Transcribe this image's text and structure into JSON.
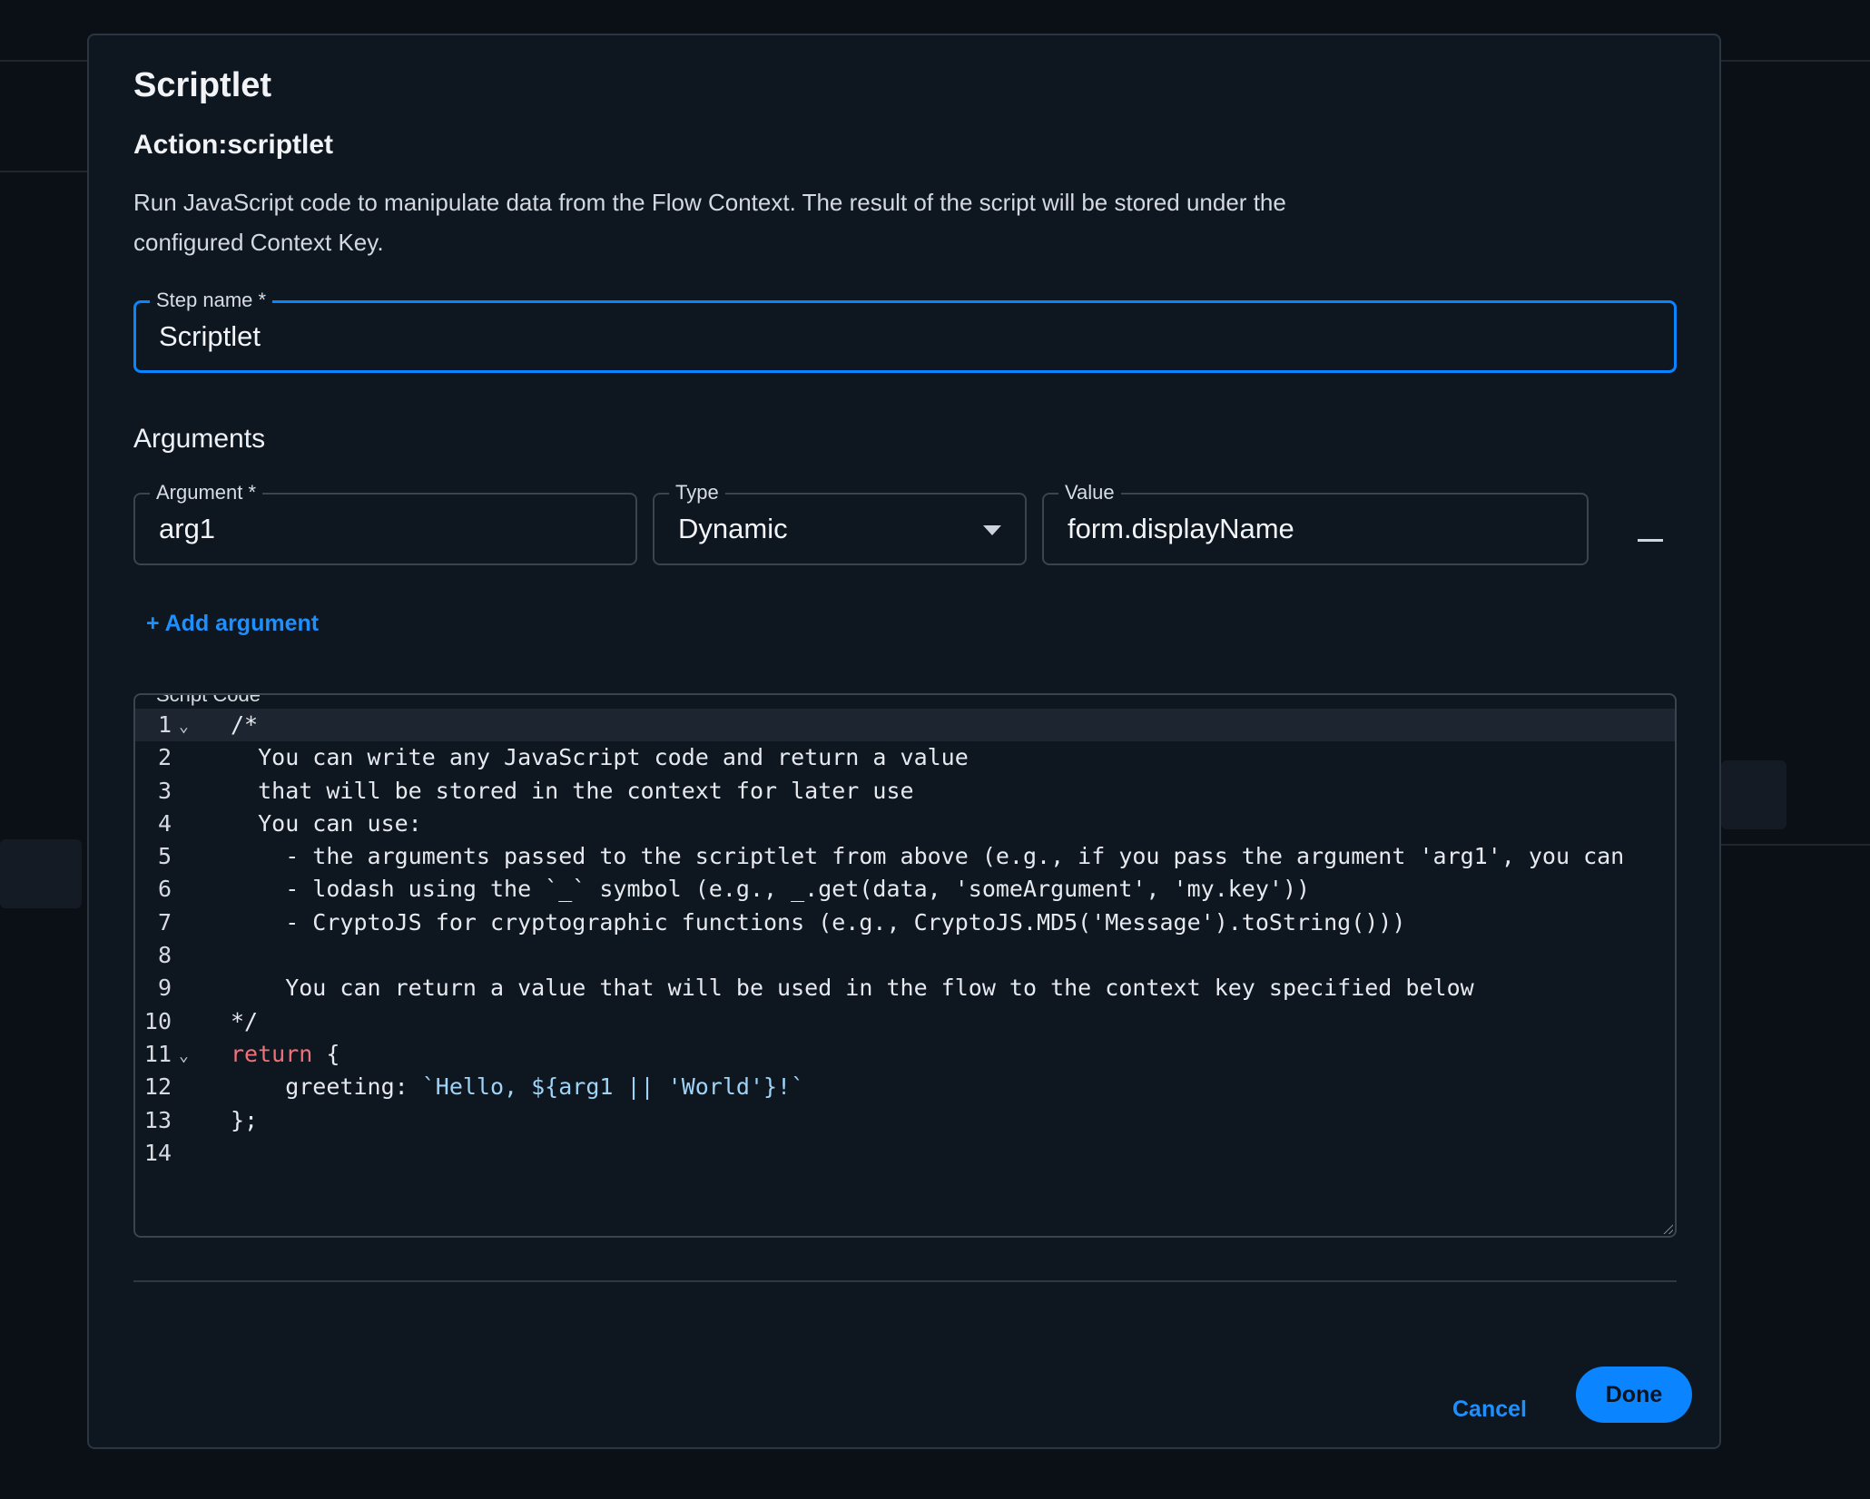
{
  "dialog": {
    "title": "Scriptlet",
    "subtitle": "Action:scriptlet",
    "description": "Run JavaScript code to manipulate data from the Flow Context. The result of the script will be stored under the configured Context Key."
  },
  "step_name": {
    "label": "Step name *",
    "value": "Scriptlet"
  },
  "arguments": {
    "section_title": "Arguments",
    "argument_label": "Argument *",
    "argument_value": "arg1",
    "type_label": "Type",
    "type_value": "Dynamic",
    "value_label": "Value",
    "value_value": "form.displayName",
    "add_label": "+ Add argument"
  },
  "script": {
    "label": "Script Code",
    "lines": [
      {
        "n": "1",
        "fold": "⌄",
        "text": "/*"
      },
      {
        "n": "2",
        "fold": "",
        "text": "  You can write any JavaScript code and return a value"
      },
      {
        "n": "3",
        "fold": "",
        "text": "  that will be stored in the context for later use"
      },
      {
        "n": "4",
        "fold": "",
        "text": "  You can use:"
      },
      {
        "n": "5",
        "fold": "",
        "text": "    - the arguments passed to the scriptlet from above (e.g., if you pass the argument 'arg1', you can"
      },
      {
        "n": "6",
        "fold": "",
        "text": "    - lodash using the `_` symbol (e.g., _.get(data, 'someArgument', 'my.key'))"
      },
      {
        "n": "7",
        "fold": "",
        "text": "    - CryptoJS for cryptographic functions (e.g., CryptoJS.MD5('Message').toString()))"
      },
      {
        "n": "8",
        "fold": "",
        "text": ""
      },
      {
        "n": "9",
        "fold": "",
        "text": "    You can return a value that will be used in the flow to the context key specified below"
      },
      {
        "n": "10",
        "fold": "",
        "text": "*/"
      },
      {
        "n": "11",
        "fold": "⌄",
        "kw": "return",
        "text": " {"
      },
      {
        "n": "12",
        "fold": "",
        "text": "    greeting: ",
        "str": "`Hello, ${arg1 || 'World'}!`"
      },
      {
        "n": "13",
        "fold": "",
        "text": "};"
      },
      {
        "n": "14",
        "fold": "",
        "text": ""
      }
    ]
  },
  "footer": {
    "cancel_label": "Cancel",
    "done_label": "Done"
  },
  "colors": {
    "accent": "#0a84ff",
    "keyword": "#f07178",
    "string": "#9fd3f7",
    "surface": "#0e1620"
  }
}
